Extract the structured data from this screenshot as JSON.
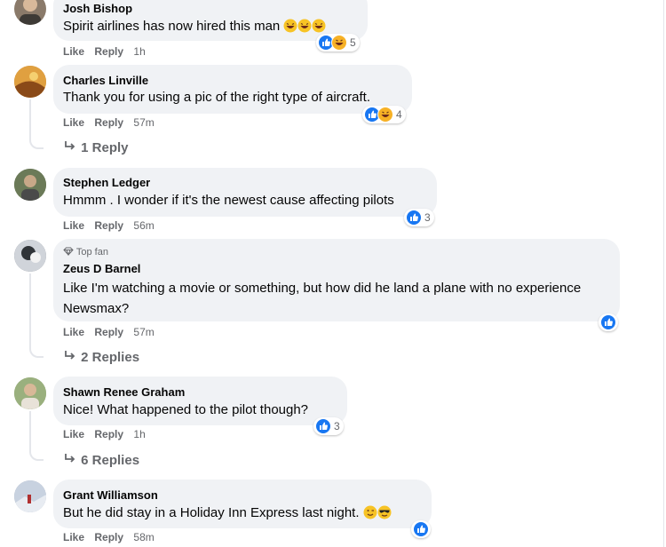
{
  "comments": [
    {
      "author": "Josh Bishop",
      "text": "Spirit airlines has now hired this man",
      "actions": {
        "like": "Like",
        "reply": "Reply",
        "time": "1h"
      },
      "reactions": {
        "count": "5",
        "icons": [
          "like-icon",
          "haha-icon"
        ]
      },
      "avatar_color": "#8a7a6a"
    },
    {
      "author": "Charles Linville",
      "text": "Thank you for using a pic of the right type of aircraft.",
      "actions": {
        "like": "Like",
        "reply": "Reply",
        "time": "57m"
      },
      "reactions": {
        "count": "4",
        "icons": [
          "like-icon",
          "haha-icon"
        ]
      },
      "replies": "1 Reply",
      "avatar_color": "#c07a2a"
    },
    {
      "author": "Stephen Ledger",
      "text": "Hmmm . I wonder if it's the newest cause affecting pilots",
      "actions": {
        "like": "Like",
        "reply": "Reply",
        "time": "56m"
      },
      "reactions": {
        "count": "3",
        "icons": [
          "like-icon"
        ]
      },
      "avatar_color": "#5a6a4a"
    },
    {
      "badge": "Top fan",
      "author": "Zeus D Barnel",
      "text": "Like I'm watching a movie or something, but how did he land a plane with no experience Newsmax?",
      "actions": {
        "like": "Like",
        "reply": "Reply",
        "time": "57m"
      },
      "reactions": {
        "count": "",
        "icons": [
          "like-icon"
        ]
      },
      "replies": "2 Replies",
      "avatar_color": "#7a8088"
    },
    {
      "author": "Shawn Renee Graham",
      "text": "Nice! What happened to the pilot though?",
      "actions": {
        "like": "Like",
        "reply": "Reply",
        "time": "1h"
      },
      "reactions": {
        "count": "3",
        "icons": [
          "like-icon"
        ]
      },
      "replies": "6 Replies",
      "avatar_color": "#8aa070"
    },
    {
      "author": "Grant Williamson",
      "text": "But he did stay in a Holiday Inn Express last night.",
      "actions": {
        "like": "Like",
        "reply": "Reply",
        "time": "58m"
      },
      "reactions": {
        "count": "",
        "icons": [
          "like-icon"
        ]
      },
      "avatar_color": "#a0a8b8"
    }
  ],
  "colors": {
    "like": "#1877f2",
    "haha": "#f7b125",
    "bubble": "#f0f2f5",
    "meta": "#65676b"
  }
}
